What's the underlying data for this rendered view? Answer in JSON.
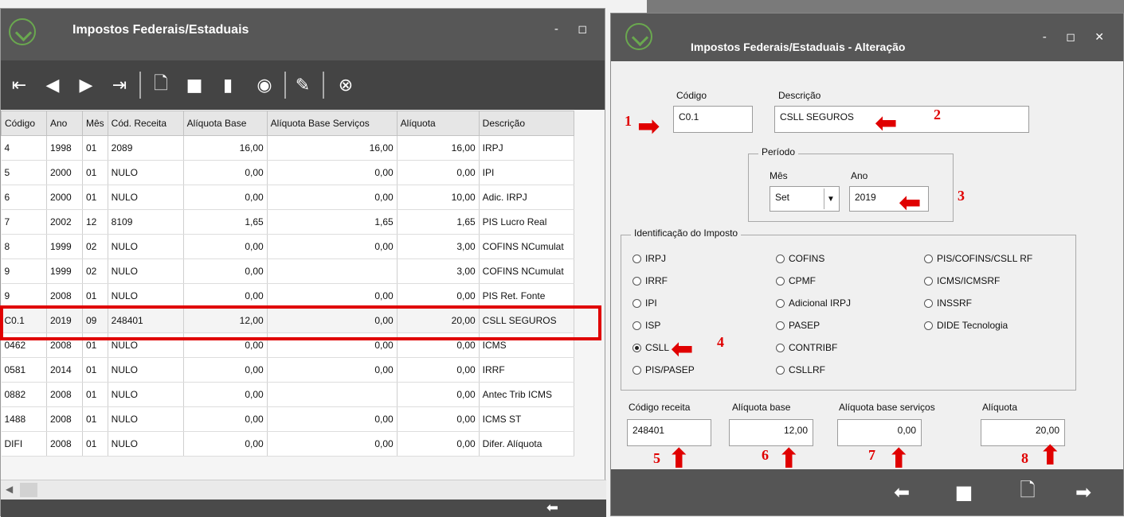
{
  "left_window": {
    "title": "Impostos Federais/Estaduais",
    "controls": "- ◻",
    "toolbar_icons": [
      "first-icon",
      "prev-icon",
      "next-icon",
      "last-icon",
      "new-icon",
      "save-icon",
      "delete-icon",
      "view-icon",
      "edit-icon",
      "copy-icon",
      "close-icon"
    ],
    "columns": [
      "Código",
      "Ano",
      "Mês",
      "Cód. Receita",
      "Alíquota Base",
      "Alíquota Base Serviços",
      "Alíquota",
      "Descrição"
    ],
    "rows": [
      [
        "4",
        "1998",
        "01",
        "2089",
        "16,00",
        "16,00",
        "16,00",
        "IRPJ"
      ],
      [
        "5",
        "2000",
        "01",
        "NULO",
        "0,00",
        "0,00",
        "0,00",
        "IPI"
      ],
      [
        "6",
        "2000",
        "01",
        "NULO",
        "0,00",
        "0,00",
        "10,00",
        "Adic. IRPJ"
      ],
      [
        "7",
        "2002",
        "12",
        "8109",
        "1,65",
        "1,65",
        "1,65",
        "PIS Lucro Real"
      ],
      [
        "8",
        "1999",
        "02",
        "NULO",
        "0,00",
        "0,00",
        "3,00",
        "COFINS NCumulat"
      ],
      [
        "9",
        "1999",
        "02",
        "NULO",
        "0,00",
        "",
        "3,00",
        "COFINS NCumulat"
      ],
      [
        "9",
        "2008",
        "01",
        "NULO",
        "0,00",
        "0,00",
        "0,00",
        "PIS Ret. Fonte"
      ],
      [
        "C0.1",
        "2019",
        "09",
        "248401",
        "12,00",
        "0,00",
        "20,00",
        "CSLL SEGUROS"
      ],
      [
        "0462",
        "2008",
        "01",
        "NULO",
        "0,00",
        "0,00",
        "0,00",
        "ICMS"
      ],
      [
        "0581",
        "2014",
        "01",
        "NULO",
        "0,00",
        "0,00",
        "0,00",
        "IRRF"
      ],
      [
        "0882",
        "2008",
        "01",
        "NULO",
        "0,00",
        "",
        "0,00",
        "Antec Trib ICMS"
      ],
      [
        "1488",
        "2008",
        "01",
        "NULO",
        "0,00",
        "0,00",
        "0,00",
        "ICMS ST"
      ],
      [
        "DIFI",
        "2008",
        "01",
        "NULO",
        "0,00",
        "0,00",
        "0,00",
        "Difer. Alíquota"
      ]
    ],
    "selected_row_index": 7
  },
  "right_window": {
    "title": "Impostos Federais/Estaduais - Alteração",
    "controls": "- ◻ ✕",
    "labels": {
      "codigo": "Código",
      "descricao": "Descrição",
      "periodo": "Período",
      "mes": "Mês",
      "ano": "Ano",
      "identificacao": "Identificação do Imposto",
      "codigo_receita": "Código receita",
      "aliquota_base": "Alíquota base",
      "aliquota_base_servicos": "Alíquota base serviços",
      "aliquota": "Alíquota"
    },
    "values": {
      "codigo": "C0.1",
      "descricao": "CSLL SEGUROS",
      "mes": "Set",
      "ano": "2019",
      "codigo_receita": "248401",
      "aliquota_base": "12,00",
      "aliquota_base_servicos": "0,00",
      "aliquota": "20,00"
    },
    "radios": [
      {
        "label": "IRPJ",
        "checked": false
      },
      {
        "label": "IRRF",
        "checked": false
      },
      {
        "label": "IPI",
        "checked": false
      },
      {
        "label": "ISP",
        "checked": false
      },
      {
        "label": "CSLL",
        "checked": true
      },
      {
        "label": "PIS/PASEP",
        "checked": false
      },
      {
        "label": "COFINS",
        "checked": false
      },
      {
        "label": "CPMF",
        "checked": false
      },
      {
        "label": "Adicional IRPJ",
        "checked": false
      },
      {
        "label": "PASEP",
        "checked": false
      },
      {
        "label": "CONTRIBF",
        "checked": false
      },
      {
        "label": "CSLLRF",
        "checked": false
      },
      {
        "label": "PIS/COFINS/CSLL RF",
        "checked": false
      },
      {
        "label": "ICMS/ICMSRF",
        "checked": false
      },
      {
        "label": "INSSRF",
        "checked": false
      },
      {
        "label": "DIDE Tecnologia",
        "checked": false
      }
    ],
    "footer_icons": [
      "back-arrow-icon",
      "save-icon",
      "new-document-icon",
      "forward-arrow-icon"
    ]
  },
  "annotations": [
    "1",
    "2",
    "3",
    "4",
    "5",
    "6",
    "7",
    "8"
  ],
  "colors": {
    "titlebar": "#575757",
    "toolbar": "#444444",
    "highlight": "#e00000"
  }
}
